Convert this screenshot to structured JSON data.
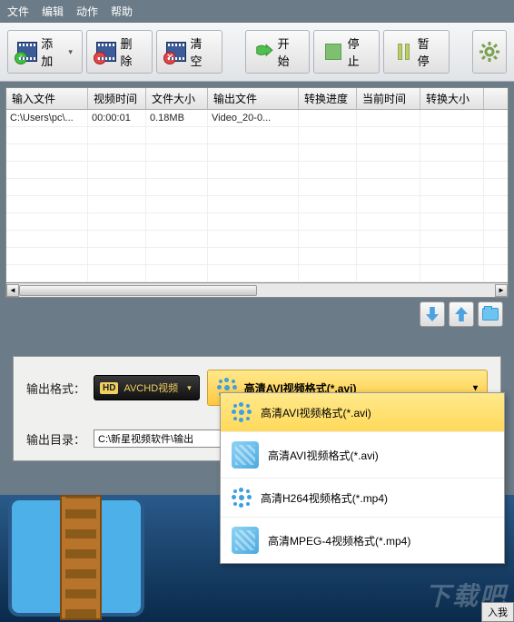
{
  "menu": {
    "file": "文件",
    "edit": "编辑",
    "action": "动作",
    "help": "帮助"
  },
  "toolbar": {
    "add": "添加",
    "delete": "删除",
    "clear": "清空",
    "start": "开始",
    "stop": "停止",
    "pause": "暂停"
  },
  "columns": {
    "input": "输入文件",
    "duration": "视频时间",
    "size": "文件大小",
    "output": "输出文件",
    "progress": "转换进度",
    "current": "当前时间",
    "out_size": "转换大小"
  },
  "rows": [
    {
      "input": "C:\\Users\\pc\\...",
      "duration": "00:00:01",
      "size": "0.18MB",
      "output": "Video_20-0...",
      "progress": "",
      "current": "",
      "out_size": ""
    }
  ],
  "settings": {
    "format_label": "输出格式：",
    "hd_badge": "HD",
    "hd_text": "AVCHD视频",
    "format_selected": "高清AVI视频格式(*.avi)",
    "dir_label": "输出目录：",
    "dir_value": "C:\\新星视频软件\\输出"
  },
  "dropdown": {
    "items": [
      {
        "label": "高清AVI视频格式(*.avi)",
        "icon": "dots",
        "selected": true
      },
      {
        "label": "高清AVI视频格式(*.avi)",
        "icon": "square",
        "selected": false
      },
      {
        "label": "高清H264视频格式(*.mp4)",
        "icon": "dots",
        "selected": false
      },
      {
        "label": "高清MPEG-4视频格式(*.mp4)",
        "icon": "square",
        "selected": false
      }
    ]
  },
  "watermark": "下载吧",
  "corner": "入我"
}
